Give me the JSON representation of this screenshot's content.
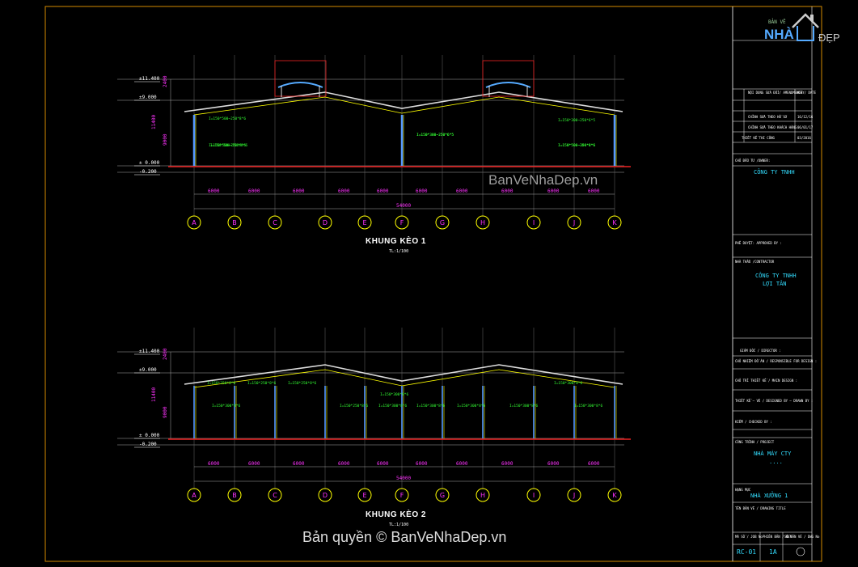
{
  "frames": [
    {
      "title": "KHUNG KÈO 1",
      "scale": "TL:1/100",
      "labels": [
        "I=150*500~250*8*6",
        "I=150*500~250*8*6",
        "I=150*300~250*6*5",
        "I=150*300~250*6*5",
        "I=150*300~250*6*5",
        "I=150*500~250*8*6",
        "I=150*500~250*8*6",
        "I=150*500~300*8*6"
      ]
    },
    {
      "title": "KHUNG KÈO 2",
      "scale": "TL:1/100",
      "labels": [
        "I=150*250*8*6",
        "I=150*250*8*6",
        "I=150*250*8*6",
        "I=150*250*8*6",
        "I=150*300*8*6",
        "I=150*300*8*6",
        "I=150*300*8*6",
        "I=150*300*8*6",
        "I=150*300*8*6",
        "I=150*300*8*6",
        "I=150*300*8*6",
        "I=150*300*8*6"
      ]
    }
  ],
  "levels": [
    "±11.400",
    "±9.000",
    "± 0.000",
    "-0.200"
  ],
  "dims": {
    "vertical": [
      "2400",
      "11400",
      "9000"
    ],
    "spans": [
      "6000",
      "6000",
      "6000",
      "6000",
      "6000",
      "6000",
      "6000",
      "6000",
      "6000",
      "6000"
    ],
    "total": "54000"
  },
  "grid_axes": [
    "A",
    "B",
    "C",
    "D",
    "E",
    "F",
    "G",
    "H",
    "I",
    "J",
    "K"
  ],
  "title_block": {
    "logo_small": "BẢN VẼ",
    "logo_big": "NHÀ",
    "logo_dep": "ĐẸP",
    "rev_head": "NỘI DUNG SỬA ĐỔI/ AMENDMENTS",
    "date_head": "NGÀY/ DATE",
    "rev_rows": [
      {
        "t": "CHỈNH SỬA THEO HỒ SƠ",
        "d": "16/12/16"
      },
      {
        "t": "CHỈNH SỬA THEO KHÁCH HÀNG",
        "d": "06/01/17"
      },
      {
        "t": "THIẾT KẾ THI CÔNG",
        "d": "03/2016"
      }
    ],
    "owner_label": "CHỦ ĐẦU TƯ /OWNER:",
    "owner": "CÔNG TY TNHH",
    "approved": "PHÊ DUYỆT: APPROVED BY :",
    "contractor_label": "NHÀ THẦU /CONTRACTOR",
    "contractor_1": "CÔNG TY TNHH",
    "contractor_2": "LỢI TÂN",
    "director": "GIÁM ĐỐC / DIRECTOR :",
    "resp": "CHỦ NHIỆM ĐỒ ÁN / RESPONSIBLE FOR DESIGN :",
    "design": "CHỦ TRÌ THIẾT KẾ / MAIN DESIGN :",
    "drawn": "THIẾT KẾ – VẼ / DESIGNED BY – DRAWN BY :",
    "checked": "KIỂM / CHECKED BY :",
    "project_label": "CÔNG TRÌNH / PROJECT",
    "project": "NHÀ MÁY CTY",
    "project_sub": "....",
    "item_label": "HẠNG MỤC",
    "item": "NHÀ XƯỞNG 1",
    "drawing_label": "TÊN BẢN VẼ / DRAWING TITLE",
    "sheet_head": "MÃ SỐ / JOB No",
    "rev_head2": "PHIÊN BẢN / REV",
    "sheet_no_head": "SỐ BẢN VẼ / DWG No",
    "sheet": "RC-01",
    "rev": "1A"
  },
  "watermarks": {
    "mid": "BanVeNhaDep.vn",
    "bottom": "Bản quyền © BanVeNhaDep.vn"
  }
}
